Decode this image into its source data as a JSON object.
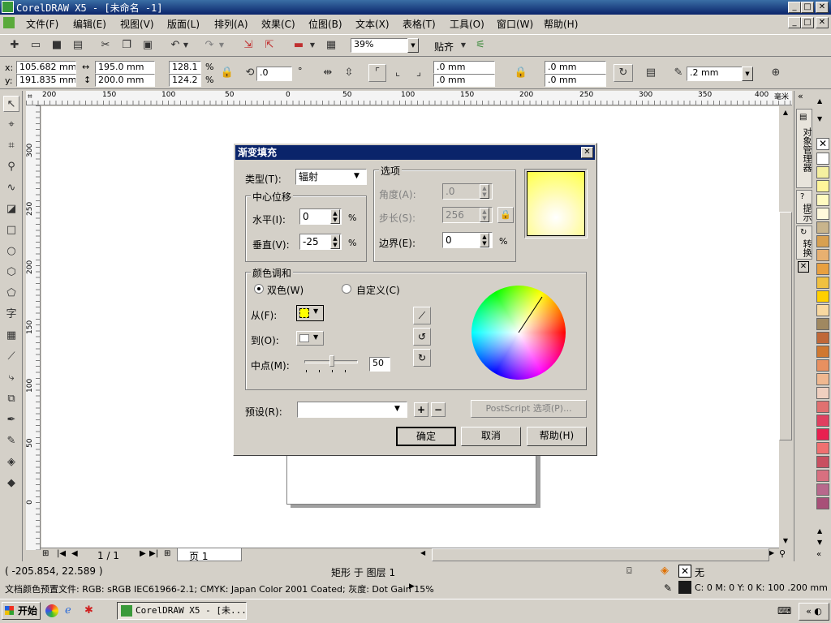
{
  "window": {
    "title": "CorelDRAW X5 - [未命名 -1]"
  },
  "menu": [
    "文件(F)",
    "编辑(E)",
    "视图(V)",
    "版面(L)",
    "排列(A)",
    "效果(C)",
    "位图(B)",
    "文本(X)",
    "表格(T)",
    "工具(O)",
    "窗口(W)",
    "帮助(H)"
  ],
  "toolbar": {
    "zoom": "39%",
    "snap_label": "贴齐"
  },
  "property_bar": {
    "x_label": "x:",
    "x": "105.682 mm",
    "y_label": "y:",
    "y": "191.835 mm",
    "w": "195.0 mm",
    "h": "200.0 mm",
    "sx": "128.1",
    "sy": "124.2",
    "pct": "%",
    "angle": ".0",
    "deg": "°",
    "c1": ".0 mm",
    "c2": ".0 mm",
    "c3": ".0 mm",
    "c4": ".0 mm",
    "outline": ".2 mm"
  },
  "ruler": {
    "h_ticks": [
      "200",
      "150",
      "100",
      "50",
      "0",
      "50",
      "100",
      "150",
      "200",
      "250",
      "300",
      "350",
      "400"
    ],
    "unit": "毫米",
    "v_ticks": [
      "300",
      "250",
      "200",
      "150",
      "100",
      "50",
      "0"
    ]
  },
  "page_nav": {
    "counter": "1 / 1",
    "tab": "页 1"
  },
  "dialog": {
    "title": "渐变填充",
    "type_label": "类型(T):",
    "type_value": "辐射",
    "center_group": "中心位移",
    "horizontal_label": "水平(I):",
    "horizontal_value": "0",
    "vertical_label": "垂直(V):",
    "vertical_value": "-25",
    "options_group": "选项",
    "angle_label": "角度(A):",
    "angle_value": ".0",
    "steps_label": "步长(S):",
    "steps_value": "256",
    "edge_label": "边界(E):",
    "edge_value": "0",
    "pct": "%",
    "blend_group": "颜色调和",
    "two_color": "双色(W)",
    "custom": "自定义(C)",
    "from_label": "从(F):",
    "to_label": "到(O):",
    "mid_label": "中点(M):",
    "mid_value": "50",
    "preset_label": "预设(R):",
    "postscript": "PostScript 选项(P)...",
    "ok": "确定",
    "cancel": "取消",
    "help": "帮助(H)"
  },
  "dockers": {
    "object_manager": "对象管理器",
    "hints": "提示",
    "transform": "转换"
  },
  "palette_colors": [
    "#ffffff",
    "#f5f0a0",
    "#fff59a",
    "#fffbc0",
    "#fffadc",
    "#c8b48c",
    "#d8a050",
    "#e8b070",
    "#e8a040",
    "#f0c040",
    "#ffd000",
    "#f8d8a0",
    "#a08860",
    "#c06838",
    "#d07830",
    "#e89060",
    "#f0b890",
    "#f0d0c0",
    "#e07070",
    "#e04060",
    "#e82050",
    "#f07070",
    "#c85060",
    "#d87080",
    "#b8688c",
    "#a85078"
  ],
  "status": {
    "coords": "( -205.854, 22.589 )",
    "selection": "矩形 于 图层 1",
    "fill_text": "无",
    "profile": "文档颜色预置文件: RGB: sRGB IEC61966-2.1; CMYK: Japan Color 2001 Coated; 灰度: Dot Gain 15%",
    "outline_text": "C: 0 M: 0 Y: 0 K: 100  .200 mm"
  },
  "taskbar": {
    "start": "开始",
    "task": "CorelDRAW X5 - [未..."
  }
}
